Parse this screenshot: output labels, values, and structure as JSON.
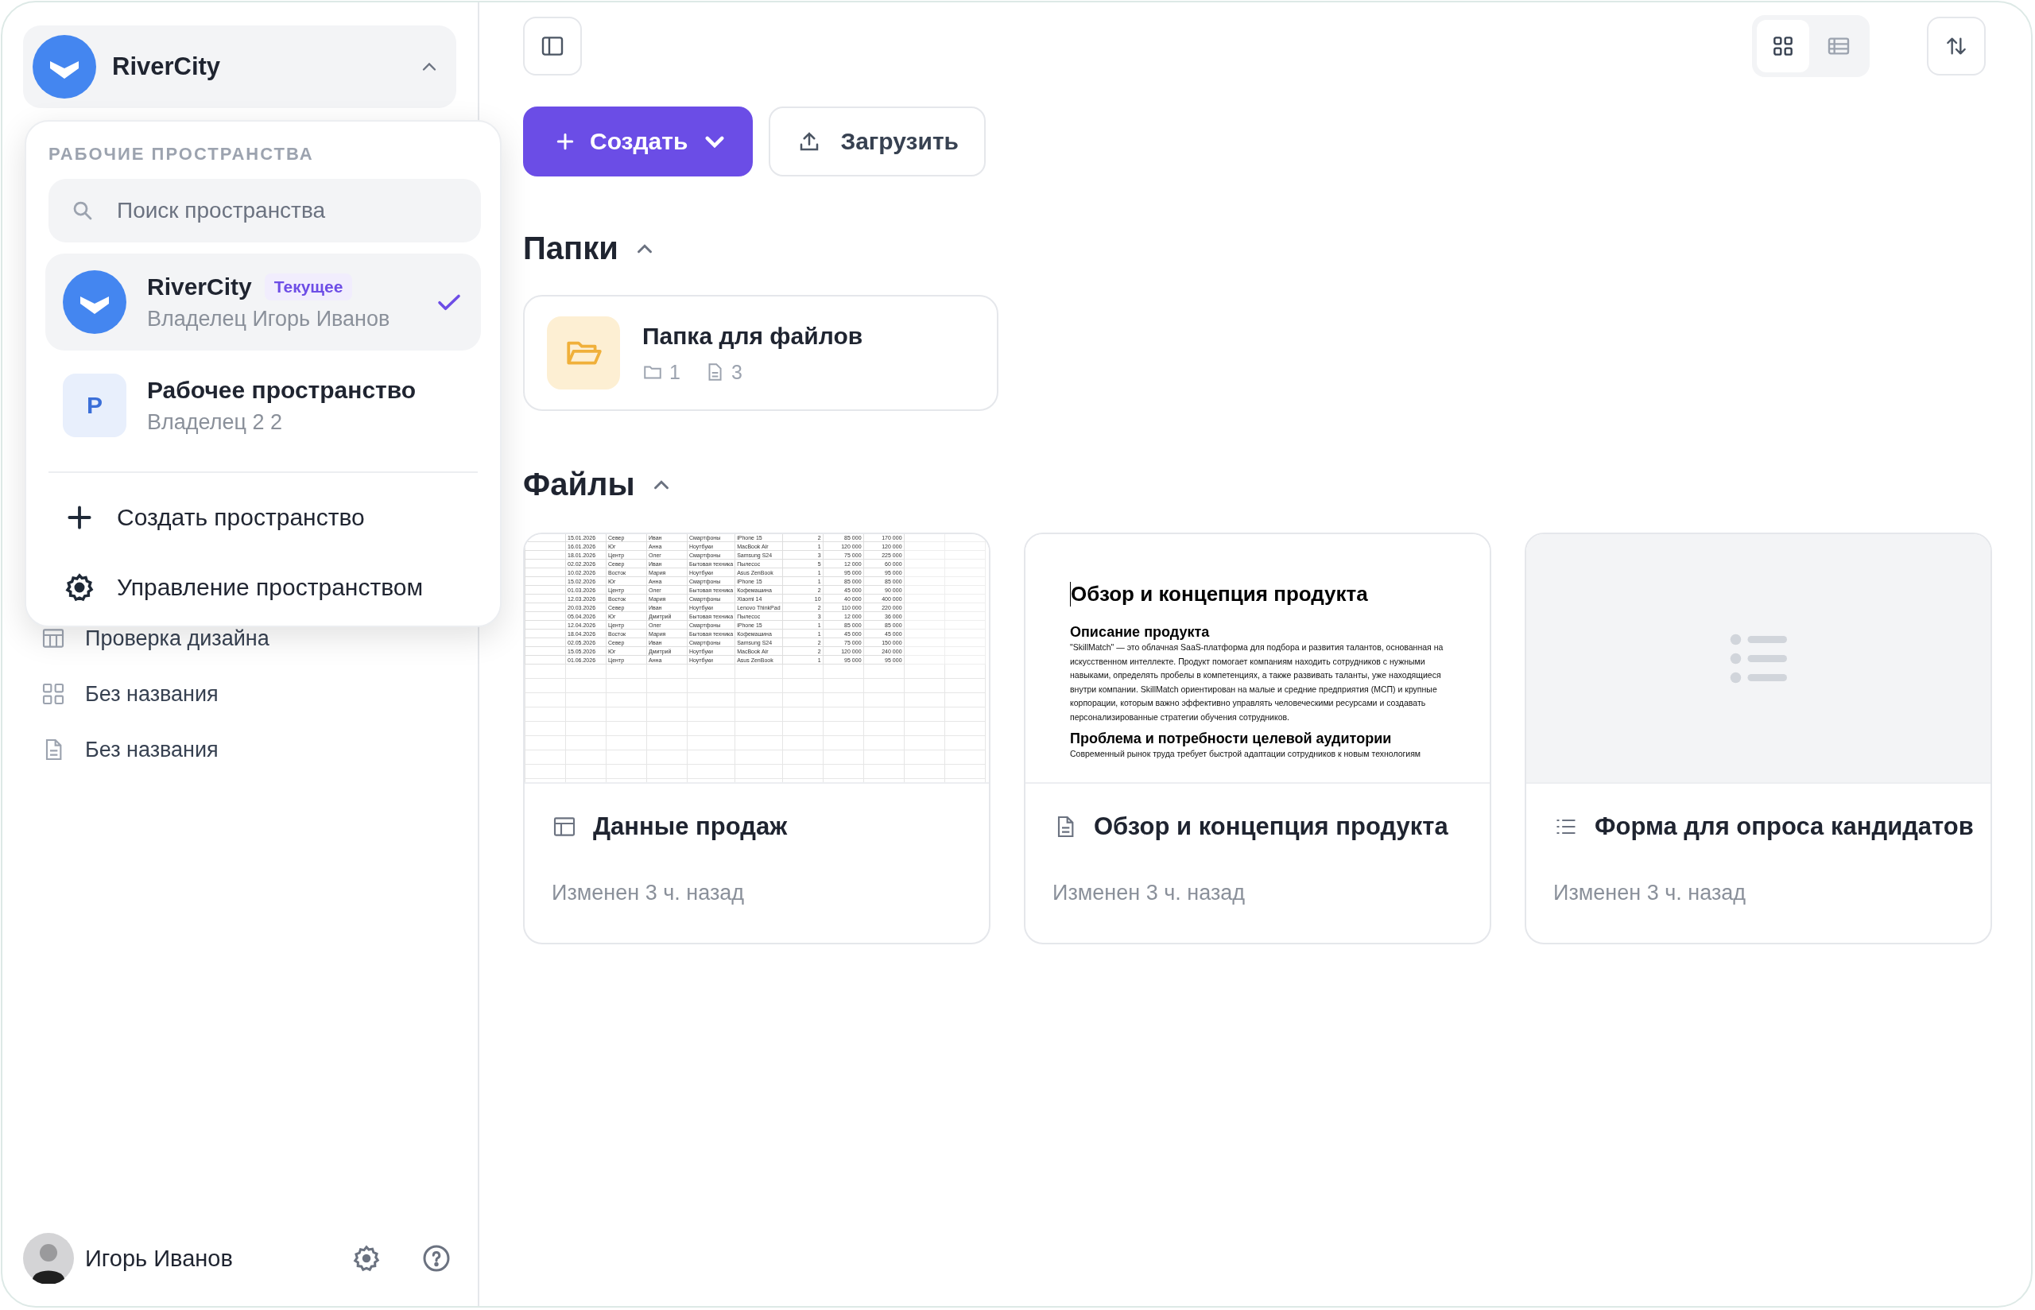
{
  "workspace_switcher": {
    "name": "RiverCity",
    "expanded": true
  },
  "workspace_menu": {
    "heading": "РАБОЧИЕ ПРОСТРАНСТВА",
    "search": {
      "placeholder": "Поиск пространства"
    },
    "workspaces": [
      {
        "kind": "logo",
        "name": "RiverCity",
        "badge": "Текущее",
        "owner": "Владелец Игорь Иванов",
        "selected": true
      },
      {
        "kind": "initial",
        "initial": "Р",
        "name": "Рабочее пространство",
        "owner": "Владелец 2 2",
        "selected": false
      }
    ],
    "actions": [
      {
        "kind": "create",
        "label": "Создать пространство"
      },
      {
        "kind": "manage",
        "label": "Управление пространством"
      }
    ]
  },
  "sidebar": {
    "items": [
      {
        "kind": "table",
        "label": "Проверка дизайна"
      },
      {
        "kind": "board",
        "label": "Без названия"
      },
      {
        "kind": "document",
        "label": "Без названия"
      }
    ]
  },
  "user": {
    "name": "Игорь Иванов"
  },
  "view_modes": [
    {
      "kind": "grid",
      "selected": true
    },
    {
      "kind": "list",
      "selected": false
    }
  ],
  "create_button": "Создать",
  "upload_button": "Загрузить",
  "folders_section": {
    "title": "Папки",
    "expanded": true,
    "folders": [
      {
        "name": "Папка для файлов",
        "subfolders": "1",
        "files": "3"
      }
    ]
  },
  "files_section": {
    "title": "Файлы",
    "expanded": true,
    "files": [
      {
        "kind": "spreadsheet",
        "name": "Данные продаж",
        "modified": "Изменен 3 ч. назад",
        "preview_rows": [
          [
            "15.01.2026",
            "Север",
            "Иван",
            "Смартфоны",
            "iPhone 15",
            "2",
            "85 000",
            "170 000"
          ],
          [
            "16.01.2026",
            "Юг",
            "Анна",
            "Ноутбуки",
            "MacBook Air",
            "1",
            "120 000",
            "120 000"
          ],
          [
            "18.01.2026",
            "Центр",
            "Олег",
            "Смартфоны",
            "Samsung S24",
            "3",
            "75 000",
            "225 000"
          ],
          [
            "02.02.2026",
            "Север",
            "Иван",
            "Бытовая техника",
            "Пылесос",
            "5",
            "12 000",
            "60 000"
          ],
          [
            "10.02.2026",
            "Восток",
            "Мария",
            "Ноутбуки",
            "Asus ZenBook",
            "1",
            "95 000",
            "95 000"
          ],
          [
            "15.02.2026",
            "Юг",
            "Анна",
            "Смартфоны",
            "iPhone 15",
            "1",
            "85 000",
            "85 000"
          ],
          [
            "01.03.2026",
            "Центр",
            "Олег",
            "Бытовая техника",
            "Кофемашина",
            "2",
            "45 000",
            "90 000"
          ],
          [
            "12.03.2026",
            "Восток",
            "Мария",
            "Смартфоны",
            "Xiaomi 14",
            "10",
            "40 000",
            "400 000"
          ],
          [
            "20.03.2026",
            "Север",
            "Иван",
            "Ноутбуки",
            "Lenovo ThinkPad",
            "2",
            "110 000",
            "220 000"
          ],
          [
            "05.04.2026",
            "Юг",
            "Дмитрий",
            "Бытовая техника",
            "Пылесос",
            "3",
            "12 000",
            "36 000"
          ],
          [
            "12.04.2026",
            "Центр",
            "Олег",
            "Смартфоны",
            "iPhone 15",
            "1",
            "85 000",
            "85 000"
          ],
          [
            "18.04.2026",
            "Восток",
            "Мария",
            "Бытовая техника",
            "Кофемашина",
            "1",
            "45 000",
            "45 000"
          ],
          [
            "02.05.2026",
            "Север",
            "Иван",
            "Смартфоны",
            "Samsung S24",
            "2",
            "75 000",
            "150 000"
          ],
          [
            "15.05.2026",
            "Юг",
            "Дмитрий",
            "Ноутбуки",
            "MacBook Air",
            "2",
            "120 000",
            "240 000"
          ],
          [
            "01.06.2026",
            "Центр",
            "Анна",
            "Ноутбуки",
            "Asus ZenBook",
            "1",
            "95 000",
            "95 000"
          ]
        ]
      },
      {
        "kind": "document",
        "name": "Обзор и концепция продукта",
        "modified": "Изменен 3 ч. назад",
        "preview": [
          {
            "kind": "title",
            "text": "Обзор и концепция продукта"
          },
          {
            "kind": "heading",
            "text": "Описание продукта"
          },
          {
            "kind": "paragraph",
            "text": "\"SkillMatch\" — это облачная SaaS-платформа для подбора и развития талантов, основанная на искусственном интеллекте. Продукт помогает компаниям находить сотрудников с нужными навыками, определять пробелы в компетенциях, а также развивать таланты, уже находящиеся внутри компании. SkillMatch ориентирован на малые и средние предприятия (МСП) и крупные корпорации, которым важно эффективно управлять человеческими ресурсами и создавать персонализированные стратегии обучения сотрудников."
          },
          {
            "kind": "heading",
            "text": "Проблема и потребности целевой аудитории"
          },
          {
            "kind": "paragraph",
            "text": "Современный рынок труда требует быстрой адаптации сотрудников к новым технологиям"
          }
        ]
      },
      {
        "kind": "form",
        "name": "Форма для опроса кандидатов",
        "modified": "Изменен 3 ч. назад"
      }
    ]
  }
}
